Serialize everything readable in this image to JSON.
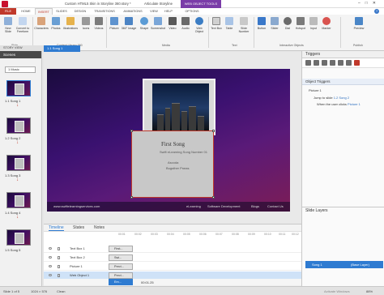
{
  "titlebar": {
    "title": "Custom HTML5 Skin in Storyline 360.story *",
    "app": "Articulate Storyline",
    "context_tab": "WEB OBJECT TOOLS"
  },
  "tabs": [
    "FILE",
    "HOME",
    "INSERT",
    "SLIDES",
    "DESIGN",
    "TRANSITIONS",
    "ANIMATIONS",
    "VIEW",
    "HELP",
    "OPTIONS"
  ],
  "ribbon": {
    "buttons": [
      "New Slide",
      "Convert to Freeform",
      "Characters",
      "Photos",
      "Illustrations",
      "Icons",
      "Videos",
      "Picture",
      "360° Image",
      "Shape",
      "Screenshot",
      "Video",
      "Audio",
      "Web Object",
      "Text Box",
      "Table",
      "Slide Number",
      "Button",
      "Slider",
      "Dial",
      "Hotspot",
      "Input",
      "Marker",
      "Preview"
    ],
    "groups": [
      "Slide",
      "Content Library 360",
      "Media",
      "Text",
      "Interactive Objects",
      "Publish"
    ]
  },
  "story_view_label": "STORY VIEW",
  "slide_tab_label": "1.1 Song 1",
  "scenes": {
    "header": "Scenes",
    "selector": "1 Music",
    "slides": [
      "1.1 Song 1",
      "1.2 Song 2",
      "1.3 Song 3",
      "1.4 Song 4",
      "1.5 Song 5"
    ]
  },
  "stage": {
    "card_title": "First Song",
    "card_line1": "Swift eLearning Song Number 01",
    "card_line2": "Ascoda",
    "card_line3": "Bugsther Pneas",
    "footer_url": "www.swiftelearningservices.com",
    "footer_links": [
      "eLearning",
      "Software Development",
      "Blogs",
      "Contact Us"
    ]
  },
  "triggers": {
    "header": "Triggers",
    "section": "Object Triggers",
    "object": "Picture 1",
    "action_prefix": "Jump to slide",
    "action_link": "1.2 Song 2",
    "condition_prefix": "When the user clicks",
    "condition_link": "Picture 1"
  },
  "slide_layers": {
    "header": "Slide Layers",
    "layer_name": "Song 1",
    "layer_tag": "(Base Layer)"
  },
  "timeline": {
    "tabs": [
      "Timeline",
      "States",
      "Notes"
    ],
    "ruler": [
      "00:01",
      "00:02",
      "00:03",
      "00:04",
      "00:05",
      "00:06",
      "00:07",
      "00:08",
      "00:09",
      "00:10",
      "00:11",
      "00:12"
    ],
    "rows": [
      {
        "name": "Text Box 1",
        "bar": "First..."
      },
      {
        "name": "Text Box 2",
        "bar": "Swi..."
      },
      {
        "name": "Picture 1",
        "bar": "Previ..."
      },
      {
        "name": "Web Object 1",
        "bar": "Previ..."
      },
      {
        "name": "",
        "bar": "Em..."
      }
    ],
    "time": "00:01.25"
  },
  "statusbar": {
    "slide": "Slide 1 of 5",
    "size": "1024 × 576",
    "state": "Clean",
    "zoom": "88%",
    "watermark": "Activate Windows"
  }
}
